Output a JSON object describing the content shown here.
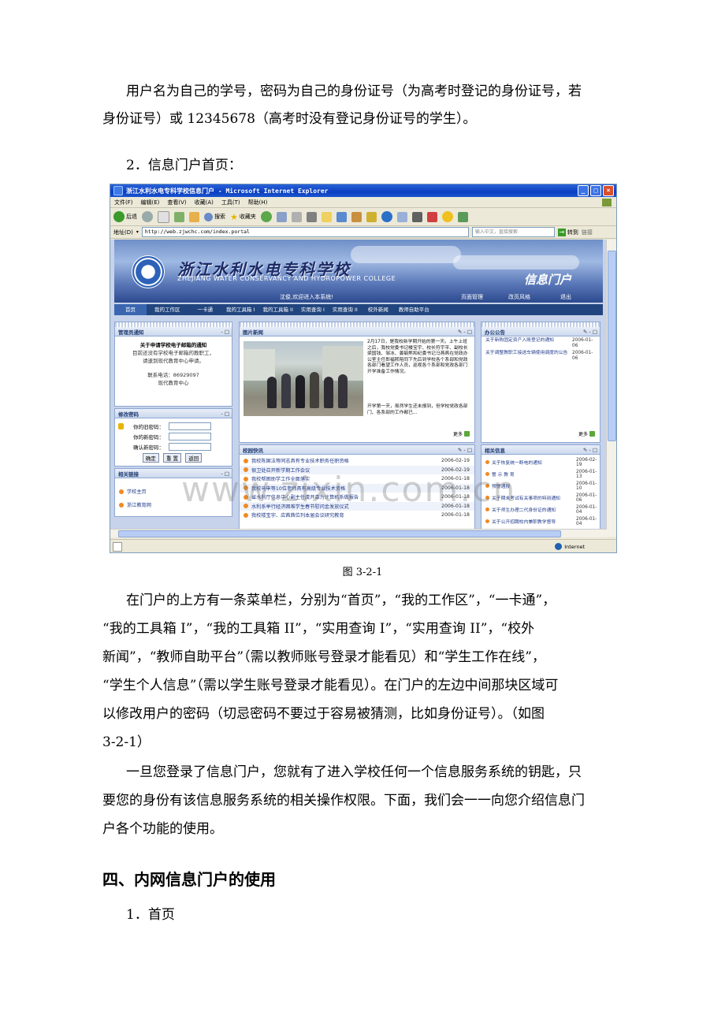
{
  "paragraphs": {
    "p1_line1": "用户名为自己的学号，密码为自己的身份证号（为高考时登记的身份证号，若",
    "p1_line2": "身份证号）或 12345678（高考时没有登记身份证号的学生）。",
    "item2": "2．信息门户首页：",
    "caption": "图  3-2-1",
    "p2_line1": "在门户的上方有一条菜单栏，分别为“首页”，“我的工作区”，“一卡通”，",
    "p2_line2": "“我的工具箱 I”，“我的工具箱 II”，“实用查询 I”，“实用查询 II”，“校外",
    "p2_line3": "新闻”，“教师自助平台”（需以教师账号登录才能看见）和“学生工作在线”，",
    "p2_line4": "“学生个人信息”（需以学生账号登录才能看见）。在门户的左边中间那块区域可",
    "p2_line5": "以修改用户的密码（切忌密码不要过于容易被猜测，比如身份证号）。（如图",
    "p2_line6": "3-2-1）",
    "p3_line1": "一旦您登录了信息门户，您就有了进入学校任何一个信息服务系统的钥匙，只",
    "p3_line2": "要您的身份有该信息服务系统的相关操作权限。下面，我们会一一向您介绍信息门",
    "p3_line3": "户各个功能的使用。",
    "heading": "四、内网信息门户的使用",
    "item1": "1．首页"
  },
  "browser": {
    "title": "浙江水利水电专科学校信息门户 - Microsoft Internet Explorer",
    "menu": [
      "文件(F)",
      "编辑(E)",
      "查看(V)",
      "收藏(A)",
      "工具(T)",
      "帮助(H)"
    ],
    "toolbar": {
      "back": "后退",
      "search": "搜索",
      "favorites": "收藏夹"
    },
    "address_label": "地址(D)",
    "address": "http://web.zjwchc.com/index.portal",
    "search_placeholder": "输入中文，直接搜索",
    "go": "转到",
    "links": "链接",
    "status_zone": "Internet"
  },
  "portal": {
    "school_cn": "浙江水利水电专科学校",
    "school_en": "ZHEJIANG WATER CONSERVANCY AND HYDROPOWER COLLEGE",
    "portal_name": "信息门户",
    "welcome": "沈俊,欢迎进入本系统!",
    "top_links": [
      "页面管理",
      "改页风格",
      "退出"
    ],
    "nav": [
      "首页",
      "我的工作区",
      "一卡通",
      "我的工具箱 I",
      "我的工具箱 II",
      "实用查询 I",
      "实用查询 II",
      "校外新闻",
      "教师自助平台"
    ],
    "admin_notice": {
      "title": "管理员通知",
      "headline": "关于申请学校电子邮箱的通知",
      "body1": "目前还没有学校电子邮箱的教职工，",
      "body2": "请速到现代教育中心申请。",
      "phone": "联系电话：86929097",
      "dept": "现代教育中心"
    },
    "change_password": {
      "title": "修改密码",
      "old": "你的旧密码：",
      "new": "你的新密码：",
      "confirm": "确认新密码：",
      "buttons": [
        "确定",
        "重 置",
        "返回"
      ]
    },
    "related_links": {
      "title": "相关链接",
      "items": [
        "学校主页",
        "浙江教育网"
      ]
    },
    "photo_news": {
      "title": "图片新闻",
      "text": "2月17日，是我校新学期开始的第一天。上午上班之后，我校党委书记楼宝宇、校长符宇平、副校长梁国钱、邹冰、姜毓熊和纪委书记马燕燕在党政办公室主任郎福熙陪同下先后到学校各个系部和党政各部门看望工作人员，巡视各个系部和党政各部门开学准备工作情况。",
      "text2": "开学第一天，虽然学生还未报到，但学校党政各部门、各系部的工作都已...",
      "more": "更多"
    },
    "campus_news": {
      "title": "校园快讯",
      "items": [
        {
          "text": "我校陈国法等同志具有专业技术职务任职资格",
          "date": "2006-02-19"
        },
        {
          "text": "很卫处召开新学期工作会议",
          "date": "2006-02-19"
        },
        {
          "text": "我校帮困助学工作全面落实",
          "date": "2006-01-18"
        },
        {
          "text": "我校马申等10位老师具有高级专业技术资格",
          "date": "2006-01-18"
        },
        {
          "text": "省水利厅信息中心副主任虞开森为计算机系做报告",
          "date": "2006-01-18"
        },
        {
          "text": "水利系举行经济困难学生春节慰问金发放仪式",
          "date": "2006-01-18"
        },
        {
          "text": "我校楼宝宇、应茜茜位列本届会议研究教育",
          "date": "2006-01-18"
        }
      ]
    },
    "office_notice": {
      "title": "办公公告",
      "items": [
        {
          "text": "关于新购固定资产入账登记的通知",
          "date": "2006-01-06"
        },
        {
          "text": "关于调整教职工接送车辆使用调度的公告",
          "date": "2006-01-06"
        }
      ],
      "more": "更多"
    },
    "related_info": {
      "title": "相关信息",
      "items": [
        {
          "text": "关于恢复统一断电的通知",
          "date": "2006-02-19"
        },
        {
          "text": "警 示 教 育",
          "date": "2006-01-13"
        },
        {
          "text": "预警通报",
          "date": "2006-01-10"
        },
        {
          "text": "关于期末考试有关事项的特别通知",
          "date": "2006-01-06"
        },
        {
          "text": "关于师生办理二代身份证的通知",
          "date": "2006-01-04"
        },
        {
          "text": "关于公开招聘校内兼职教学督导",
          "date": "2006-01-04"
        }
      ]
    },
    "watermark": "www.zixin.com.cn"
  }
}
